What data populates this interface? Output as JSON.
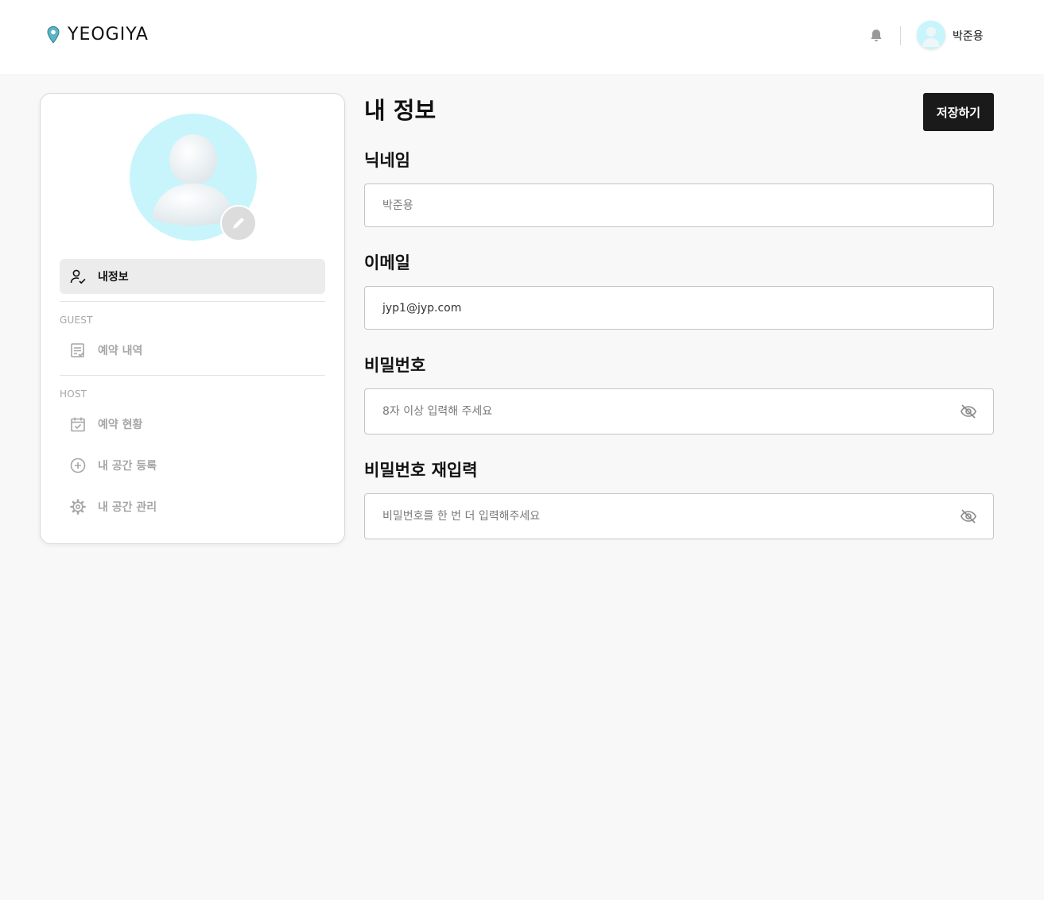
{
  "header": {
    "brand": "YEOGIYA",
    "username": "박준용"
  },
  "sidebar": {
    "profile_item": {
      "label": "내정보",
      "active": true
    },
    "guest_section": {
      "label": "GUEST",
      "items": [
        {
          "label": "예약 내역"
        }
      ]
    },
    "host_section": {
      "label": "HOST",
      "items": [
        {
          "label": "예약 현황"
        },
        {
          "label": "내 공간 등록"
        },
        {
          "label": "내 공간 관리"
        }
      ]
    }
  },
  "main": {
    "title": "내 정보",
    "save_label": "저장하기",
    "fields": {
      "nickname": {
        "label": "닉네임",
        "value": "",
        "placeholder": "박준용"
      },
      "email": {
        "label": "이메일",
        "value": "jyp1@jyp.com",
        "placeholder": ""
      },
      "password": {
        "label": "비밀번호",
        "value": "",
        "placeholder": "8자 이상 입력해 주세요"
      },
      "password_confirm": {
        "label": "비밀번호 재입력",
        "value": "",
        "placeholder": "비밀번호를 한 번 더 입력해주세요"
      }
    }
  },
  "icons": {
    "logo": "map-pin-icon",
    "notification": "bell-icon",
    "edit_avatar": "pencil-icon",
    "profile_item": "user-check-icon",
    "guest_items": [
      "list-check-icon"
    ],
    "host_items": [
      "calendar-check-icon",
      "plus-circle-icon",
      "gear-icon"
    ],
    "password_toggle": "eye-off-icon"
  },
  "colors": {
    "accent_avatar_bg": "#c7f5fb",
    "logo_pin": "#5ab4c8",
    "save_button_bg": "#1a1a1a",
    "active_menu_bg": "#ececec",
    "inactive_menu_text": "#a6a6a6"
  }
}
